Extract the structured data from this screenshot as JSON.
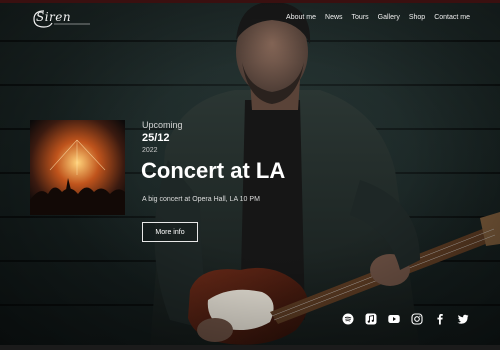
{
  "brand": {
    "logo_text": "Siren"
  },
  "nav": {
    "items": [
      {
        "label": "About me"
      },
      {
        "label": "News"
      },
      {
        "label": "Tours"
      },
      {
        "label": "Gallery"
      },
      {
        "label": "Shop"
      },
      {
        "label": "Contact me"
      }
    ]
  },
  "concert": {
    "eyebrow": "Upcoming",
    "date": "25/12",
    "year": "2022",
    "title": "Concert at LA",
    "description": "A big concert at Opera Hall, LA 10 PM",
    "button_label": "More info"
  },
  "socials": [
    {
      "icon": "spotify-icon"
    },
    {
      "icon": "music-icon"
    },
    {
      "icon": "youtube-icon"
    },
    {
      "icon": "instagram-icon"
    },
    {
      "icon": "facebook-icon"
    },
    {
      "icon": "twitter-icon"
    }
  ],
  "colors": {
    "accent_top": "#3a1010",
    "text": "#ffffff",
    "background": "#182322"
  }
}
